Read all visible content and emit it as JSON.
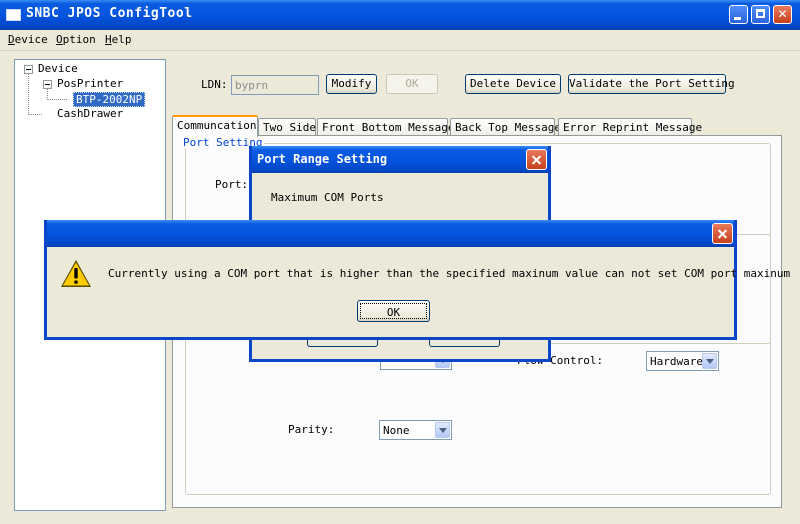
{
  "window": {
    "title": "SNBC JPOS ConfigTool"
  },
  "menu": [
    {
      "key": "D",
      "rest": "evice"
    },
    {
      "key": "O",
      "rest": "ption"
    },
    {
      "key": "H",
      "rest": "elp"
    }
  ],
  "tree": {
    "root": "Device",
    "child": "PosPrinter",
    "selected": "BTP-2002NP",
    "sibling": "CashDrawer"
  },
  "toolbar": {
    "ldn_label": "LDN:",
    "ldn_value": "byprn",
    "modify": "Modify",
    "ok": "OK",
    "delete": "Delete Device",
    "validate": "Validate the Port Setting"
  },
  "tabs": [
    "Communcation",
    "Two Side",
    "Front Bottom Message",
    "Back Top Message",
    "Error Reprint Message"
  ],
  "port_setting": {
    "legend": "Port Setting",
    "port_label": "Port:",
    "flow_control_label": "Flow Control:",
    "flow_control_value": "Hardware",
    "parity_label": "Parity:",
    "parity_value": "None"
  },
  "port_dialog": {
    "title": "Port Range Setting",
    "max_label": "Maximum COM Ports"
  },
  "alert": {
    "icon": "warning-icon",
    "message": "Currently using a COM port that is higher than the specified maxinum value can not set COM port maxinum",
    "ok": "OK"
  },
  "colors": {
    "titlebar": "#0554e0",
    "selection": "#316ac5",
    "legend_text": "#0046d5",
    "tab_accent": "#ff9900",
    "warning": "#ffcc00"
  }
}
